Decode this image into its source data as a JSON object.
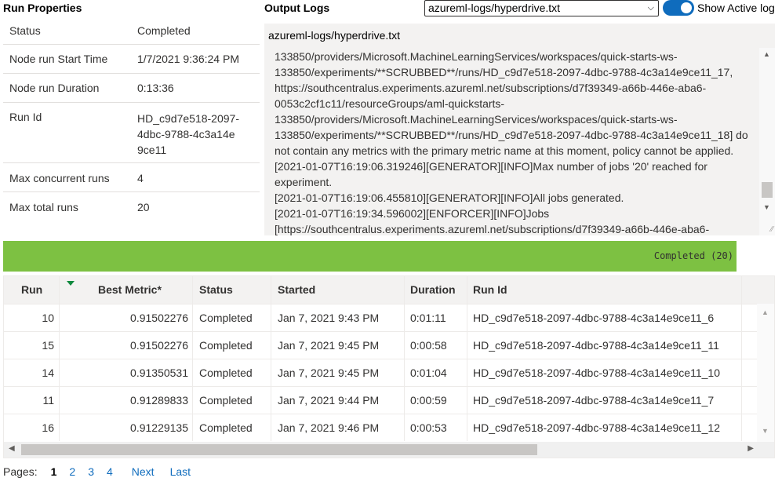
{
  "run_properties": {
    "title": "Run Properties",
    "rows": [
      {
        "key": "Status",
        "value": "Completed"
      },
      {
        "key": "Node run Start Time",
        "value": "1/7/2021 9:36:24 PM"
      },
      {
        "key": "Node run Duration",
        "value": "0:13:36"
      },
      {
        "key": "Run Id",
        "value": "HD_c9d7e518-2097-4dbc-9788-4c3a14e9ce11"
      },
      {
        "key": "Max concurrent runs",
        "value": "4"
      },
      {
        "key": "Max total runs",
        "value": "20"
      }
    ]
  },
  "output_logs": {
    "title": "Output Logs",
    "selected_log": "azureml-logs/hyperdrive.txt",
    "toggle_label": "Show Active log",
    "toggle_on": true,
    "file_header": "azureml-logs/hyperdrive.txt",
    "lines": [
      "133850/providers/Microsoft.MachineLearningServices/workspaces/quick-starts-ws-",
      "133850/experiments/**SCRUBBED**/runs/HD_c9d7e518-2097-4dbc-9788-4c3a14e9ce11_17,",
      "https://southcentralus.experiments.azureml.net/subscriptions/d7f39349-a66b-446e-aba6-",
      "0053c2cf1c11/resourceGroups/aml-quickstarts-",
      "133850/providers/Microsoft.MachineLearningServices/workspaces/quick-starts-ws-",
      "133850/experiments/**SCRUBBED**/runs/HD_c9d7e518-2097-4dbc-9788-4c3a14e9ce11_18] do",
      "not contain any metrics with the primary metric name at this moment, policy cannot be applied.",
      "[2021-01-07T16:19:06.319246][GENERATOR][INFO]Max number of jobs '20' reached for",
      "experiment.",
      "[2021-01-07T16:19:06.455810][GENERATOR][INFO]All jobs generated.",
      "[2021-01-07T16:19:34.596002][ENFORCER][INFO]Jobs",
      "[https://southcentralus.experiments.azureml.net/subscriptions/d7f39349-a66b-446e-aba6-"
    ]
  },
  "progress": {
    "label": "Completed (20)",
    "color": "#7dc142",
    "fraction": 1.0
  },
  "table": {
    "headers": {
      "run": "Run",
      "best_metric": "Best Metric*",
      "status": "Status",
      "started": "Started",
      "duration": "Duration",
      "run_id": "Run Id"
    },
    "sort_column": "best_metric",
    "rows": [
      {
        "run": "10",
        "best_metric": "0.91502276",
        "status": "Completed",
        "started": "Jan 7, 2021 9:43 PM",
        "duration": "0:01:11",
        "run_id": "HD_c9d7e518-2097-4dbc-9788-4c3a14e9ce11_6"
      },
      {
        "run": "15",
        "best_metric": "0.91502276",
        "status": "Completed",
        "started": "Jan 7, 2021 9:45 PM",
        "duration": "0:00:58",
        "run_id": "HD_c9d7e518-2097-4dbc-9788-4c3a14e9ce11_11"
      },
      {
        "run": "14",
        "best_metric": "0.91350531",
        "status": "Completed",
        "started": "Jan 7, 2021 9:45 PM",
        "duration": "0:01:04",
        "run_id": "HD_c9d7e518-2097-4dbc-9788-4c3a14e9ce11_10"
      },
      {
        "run": "11",
        "best_metric": "0.91289833",
        "status": "Completed",
        "started": "Jan 7, 2021 9:44 PM",
        "duration": "0:00:59",
        "run_id": "HD_c9d7e518-2097-4dbc-9788-4c3a14e9ce11_7"
      },
      {
        "run": "16",
        "best_metric": "0.91229135",
        "status": "Completed",
        "started": "Jan 7, 2021 9:46 PM",
        "duration": "0:00:53",
        "run_id": "HD_c9d7e518-2097-4dbc-9788-4c3a14e9ce11_12"
      }
    ]
  },
  "pagination": {
    "label": "Pages:",
    "pages": [
      "1",
      "2",
      "3",
      "4"
    ],
    "current": "1",
    "next_label": "Next",
    "last_label": "Last"
  }
}
